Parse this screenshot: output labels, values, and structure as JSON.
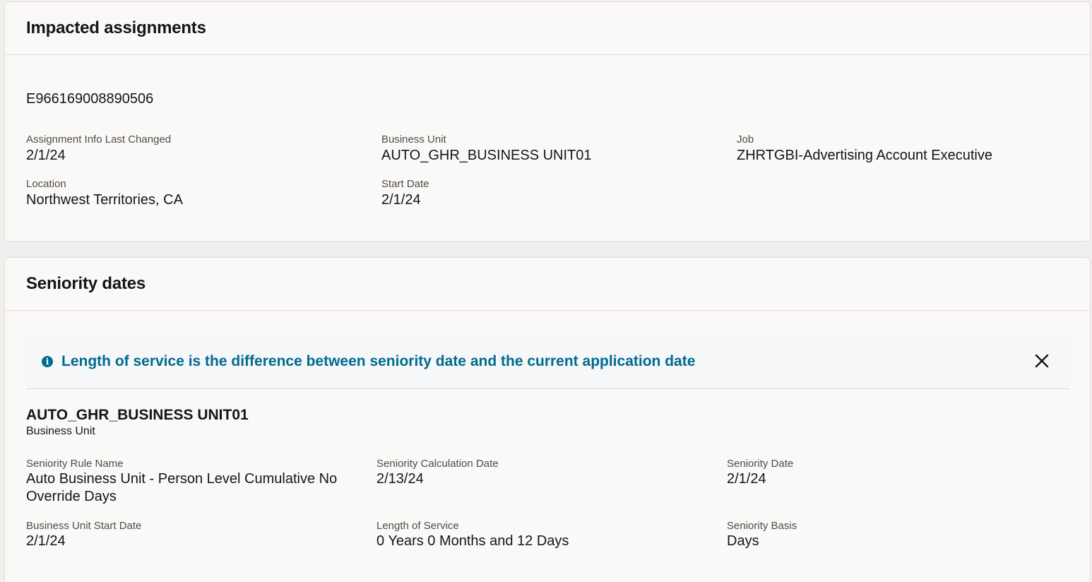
{
  "impacted": {
    "title": "Impacted assignments",
    "assignment_number": "E966169008890506",
    "fields": {
      "info_changed": {
        "label": "Assignment Info Last Changed",
        "value": "2/1/24"
      },
      "business_unit": {
        "label": "Business Unit",
        "value": "AUTO_GHR_BUSINESS UNIT01"
      },
      "job": {
        "label": "Job",
        "value": "ZHRTGBI-Advertising Account Executive"
      },
      "location": {
        "label": "Location",
        "value": "Northwest Territories, CA"
      },
      "start_date": {
        "label": "Start Date",
        "value": "2/1/24"
      }
    }
  },
  "seniority": {
    "title": "Seniority dates",
    "banner": {
      "text": "Length of service is the difference between seniority date and the current application date",
      "icon": "info-icon",
      "close_icon": "close-icon",
      "accent_color": "#006b8f"
    },
    "section": {
      "name": "AUTO_GHR_BUSINESS UNIT01",
      "subtitle": "Business Unit"
    },
    "fields": {
      "rule_name": {
        "label": "Seniority Rule Name",
        "value": "Auto Business Unit - Person Level Cumulative No Override Days"
      },
      "calc_date": {
        "label": "Seniority Calculation Date",
        "value": "2/13/24"
      },
      "seniority_date": {
        "label": "Seniority Date",
        "value": "2/1/24"
      },
      "bu_start_date": {
        "label": "Business Unit Start Date",
        "value": "2/1/24"
      },
      "length_of_service": {
        "label": "Length of Service",
        "value": "0 Years 0 Months and 12 Days"
      },
      "basis": {
        "label": "Seniority Basis",
        "value": "Days"
      }
    }
  }
}
